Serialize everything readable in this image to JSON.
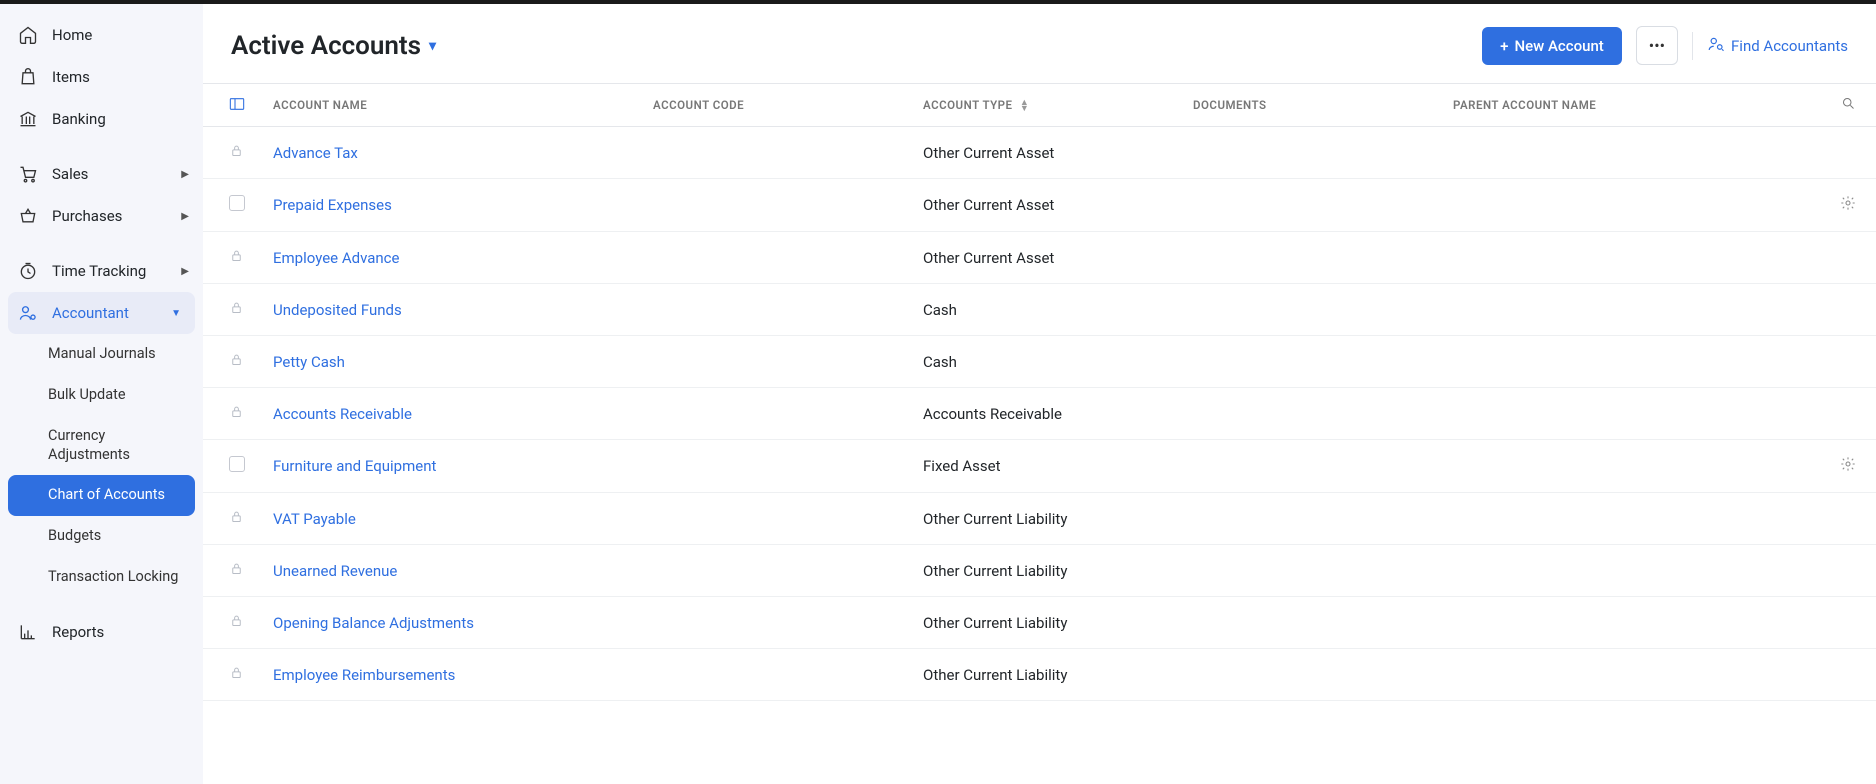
{
  "sidebar": {
    "home": "Home",
    "items": "Items",
    "banking": "Banking",
    "sales": "Sales",
    "purchases": "Purchases",
    "time_tracking": "Time Tracking",
    "accountant": "Accountant",
    "sub": {
      "manual_journals": "Manual Journals",
      "bulk_update": "Bulk Update",
      "currency_adjustments": "Currency Adjustments",
      "chart_of_accounts": "Chart of Accounts",
      "budgets": "Budgets",
      "transaction_locking": "Transaction Locking"
    },
    "reports": "Reports"
  },
  "header": {
    "title": "Active Accounts",
    "new_account": "New Account",
    "find_accountants": "Find Accountants"
  },
  "columns": {
    "name": "Account Name",
    "code": "Account Code",
    "type": "Account Type",
    "documents": "Documents",
    "parent": "Parent Account Name"
  },
  "rows": [
    {
      "name": "Advance Tax",
      "type": "Other Current Asset",
      "locked": true
    },
    {
      "name": "Prepaid Expenses",
      "type": "Other Current Asset",
      "locked": false
    },
    {
      "name": "Employee Advance",
      "type": "Other Current Asset",
      "locked": true
    },
    {
      "name": "Undeposited Funds",
      "type": "Cash",
      "locked": true
    },
    {
      "name": "Petty Cash",
      "type": "Cash",
      "locked": true
    },
    {
      "name": "Accounts Receivable",
      "type": "Accounts Receivable",
      "locked": true
    },
    {
      "name": "Furniture and Equipment",
      "type": "Fixed Asset",
      "locked": false
    },
    {
      "name": "VAT Payable",
      "type": "Other Current Liability",
      "locked": true
    },
    {
      "name": "Unearned Revenue",
      "type": "Other Current Liability",
      "locked": true
    },
    {
      "name": "Opening Balance Adjustments",
      "type": "Other Current Liability",
      "locked": true
    },
    {
      "name": "Employee Reimbursements",
      "type": "Other Current Liability",
      "locked": true
    }
  ]
}
